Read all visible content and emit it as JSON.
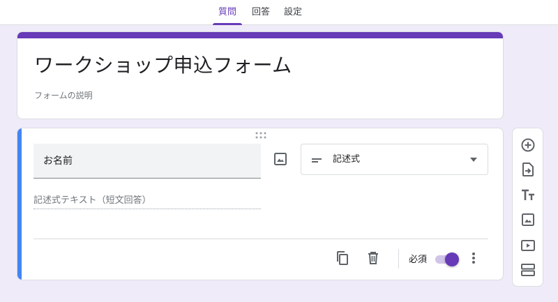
{
  "tabs": [
    {
      "label": "質問",
      "active": true
    },
    {
      "label": "回答",
      "active": false
    },
    {
      "label": "設定",
      "active": false
    }
  ],
  "form": {
    "title": "ワークショップ申込フォーム",
    "description": "フォームの説明"
  },
  "question": {
    "title": "お名前",
    "type_label": "記述式",
    "answer_placeholder": "記述式テキスト（短文回答）",
    "required_label": "必須",
    "required": true
  },
  "icons": {
    "drag": "drag-handle-icon",
    "image": "image-icon",
    "short_answer": "short-answer-icon",
    "dropdown": "chevron-down-icon",
    "duplicate": "duplicate-icon",
    "delete": "trash-icon",
    "more": "more-vert-icon",
    "side_tools": [
      "add-circle-icon",
      "import-icon",
      "title-text-icon",
      "image-icon",
      "video-icon",
      "section-icon"
    ]
  },
  "colors": {
    "accent": "#673ab7",
    "question_highlight": "#4285f4",
    "background": "#f0ebf8"
  }
}
